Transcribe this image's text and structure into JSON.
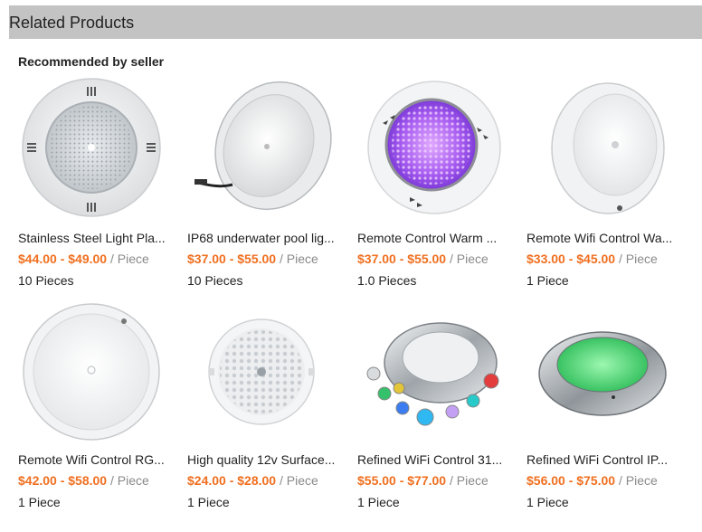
{
  "header": {
    "title": "Related Products"
  },
  "section": {
    "subtitle": "Recommended by seller"
  },
  "colors": {
    "price": "#f06f1f",
    "header_bg": "#c3c3c3"
  },
  "products": [
    {
      "name": "Stainless Steel Light Pla...",
      "price": "$44.00 - $49.00",
      "unit": "/ Piece",
      "moq": "10 Pieces",
      "image": "round white pool light with vents"
    },
    {
      "name": "IP68 underwater pool lig...",
      "price": "$37.00 - $55.00",
      "unit": "/ Piece",
      "moq": "10 Pieces",
      "image": "angled white pool light with cable"
    },
    {
      "name": "Remote Control Warm ...",
      "price": "$37.00 - $55.00",
      "unit": "/ Piece",
      "moq": "1.0 Pieces",
      "image": "purple lit pool light"
    },
    {
      "name": "Remote Wifi Control Wa...",
      "price": "$33.00 - $45.00",
      "unit": "/ Piece",
      "moq": "1 Piece",
      "image": "thin white wall-mounted pool light"
    },
    {
      "name": "Remote Wifi Control RG...",
      "price": "$42.00 - $58.00",
      "unit": "/ Piece",
      "moq": "1 Piece",
      "image": "flat white round pool light"
    },
    {
      "name": "High quality 12v Surface...",
      "price": "$24.00 - $28.00",
      "unit": "/ Piece",
      "moq": "1 Piece",
      "image": "white LED panel pool light"
    },
    {
      "name": "Refined WiFi Control 31...",
      "price": "$55.00 - $77.00",
      "unit": "/ Piece",
      "moq": "1 Piece",
      "image": "stainless pool light with colored mini lights"
    },
    {
      "name": "Refined WiFi Control IP...",
      "price": "$56.00 - $75.00",
      "unit": "/ Piece",
      "moq": "1 Piece",
      "image": "stainless pool light with green glow"
    }
  ]
}
